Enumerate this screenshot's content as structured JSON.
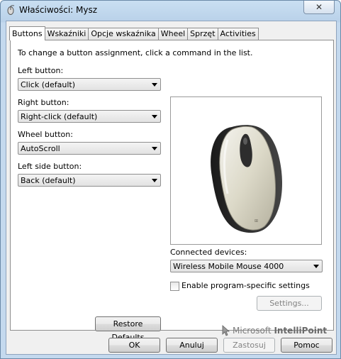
{
  "window": {
    "title": "Właściwości: Mysz",
    "close_glyph": "✕",
    "icon": "mouse-icon"
  },
  "tabs": [
    {
      "label": "Buttons",
      "active": true
    },
    {
      "label": "Wskaźniki",
      "active": false
    },
    {
      "label": "Opcje wskaźnika",
      "active": false
    },
    {
      "label": "Wheel",
      "active": false
    },
    {
      "label": "Sprzęt",
      "active": false
    },
    {
      "label": "Activities",
      "active": false
    }
  ],
  "buttons_tab": {
    "instruction": "To change a button assignment, click a command in the list.",
    "left_button": {
      "label": "Left button:",
      "value": "Click (default)"
    },
    "right_button": {
      "label": "Right button:",
      "value": "Right-click (default)"
    },
    "wheel_button": {
      "label": "Wheel button:",
      "value": "AutoScroll"
    },
    "left_side_button": {
      "label": "Left side button:",
      "value": "Back (default)"
    },
    "connected_devices": {
      "label": "Connected devices:",
      "value": "Wireless Mobile Mouse 4000"
    },
    "program_specific": {
      "label": "Enable program-specific settings",
      "checked": false
    },
    "settings_button": "Settings...",
    "restore_button": "Restore Defaults",
    "brand_prefix": "Microsoft",
    "brand_name": "IntelliPoint"
  },
  "footer": {
    "ok": "OK",
    "cancel": "Anuluj",
    "apply": "Zastosuj",
    "help": "Pomoc"
  },
  "colors": {
    "title_bar": "#c9dff2",
    "dialog_bg": "#f0f0f0",
    "panel_bg": "#ffffff"
  }
}
